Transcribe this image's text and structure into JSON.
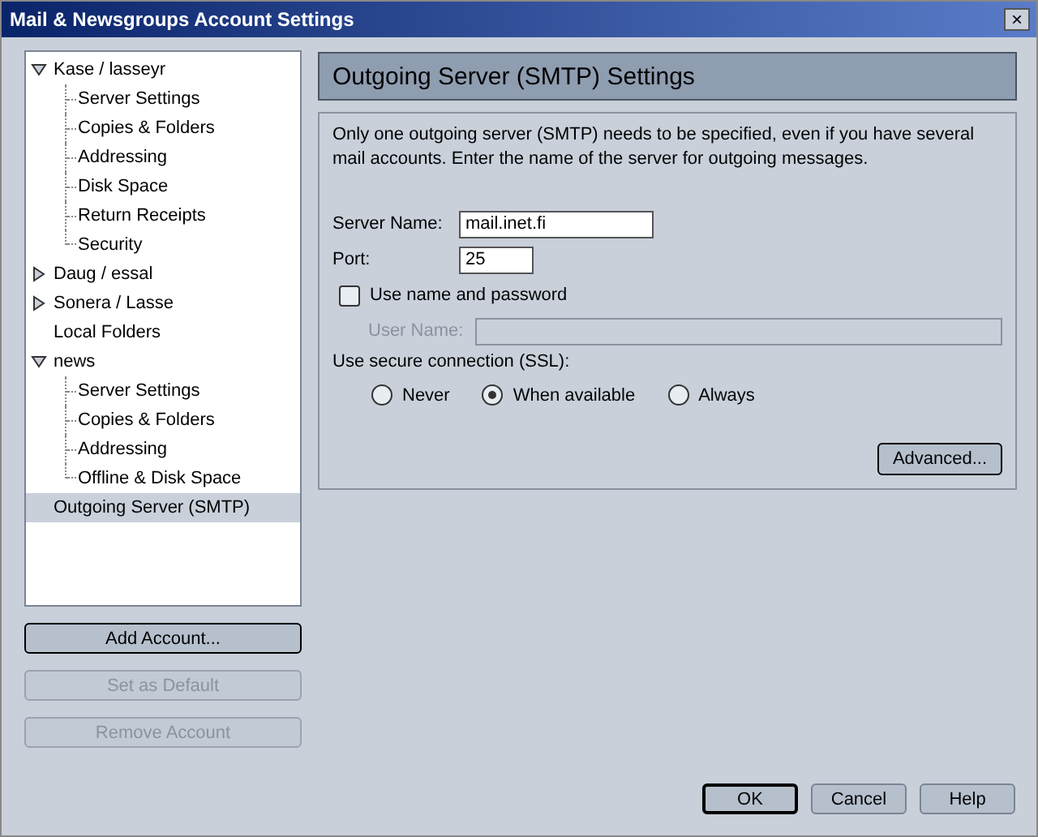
{
  "window": {
    "title": "Mail & Newsgroups Account Settings",
    "close": "×"
  },
  "tree": [
    {
      "label": "Kase / lasseyr",
      "selected": false,
      "expanded": true,
      "children": [
        {
          "label": "Server Settings",
          "selected": false
        },
        {
          "label": "Copies & Folders",
          "selected": false
        },
        {
          "label": "Addressing",
          "selected": false
        },
        {
          "label": "Disk Space",
          "selected": false
        },
        {
          "label": "Return Receipts",
          "selected": false
        },
        {
          "label": "Security",
          "selected": false
        }
      ]
    },
    {
      "label": "Daug / essal",
      "selected": false,
      "expanded": false
    },
    {
      "label": "Sonera / Lasse",
      "selected": false,
      "expanded": false
    },
    {
      "label": "Local Folders",
      "selected": false
    },
    {
      "label": "news",
      "selected": false,
      "expanded": true,
      "children": [
        {
          "label": "Server Settings",
          "selected": false
        },
        {
          "label": "Copies & Folders",
          "selected": false
        },
        {
          "label": "Addressing",
          "selected": false
        },
        {
          "label": "Offline & Disk Space",
          "selected": false
        }
      ]
    },
    {
      "label": "Outgoing Server (SMTP)",
      "selected": true
    }
  ],
  "account_buttons": [
    {
      "label": "Add Account...",
      "disabled": false,
      "default": true
    },
    {
      "label": "Set as Default",
      "disabled": true,
      "default": false
    },
    {
      "label": "Remove Account",
      "disabled": true,
      "default": false
    }
  ],
  "panel": {
    "title": "Outgoing Server (SMTP) Settings",
    "description": "Only one outgoing server (SMTP) needs to be specified, even if you have several mail accounts. Enter the name of the server for outgoing messages.",
    "server_name": {
      "label": "Server Name:",
      "value": "mail.inet.fi"
    },
    "port": {
      "label": "Port:",
      "value": "25"
    },
    "use_password": {
      "label": "Use name and password",
      "checked": false
    },
    "user_name": {
      "label": "User Name:",
      "disabled": true
    },
    "ssl": {
      "label": "Use secure connection (SSL):",
      "options": [
        {
          "label": "Never",
          "selected": false
        },
        {
          "label": "When available",
          "selected": true
        },
        {
          "label": "Always",
          "selected": false
        }
      ]
    },
    "advanced_button": "Advanced..."
  },
  "dialog_buttons": [
    {
      "label": "OK",
      "default": true
    },
    {
      "label": "Cancel",
      "default": false
    },
    {
      "label": "Help",
      "default": false
    }
  ]
}
